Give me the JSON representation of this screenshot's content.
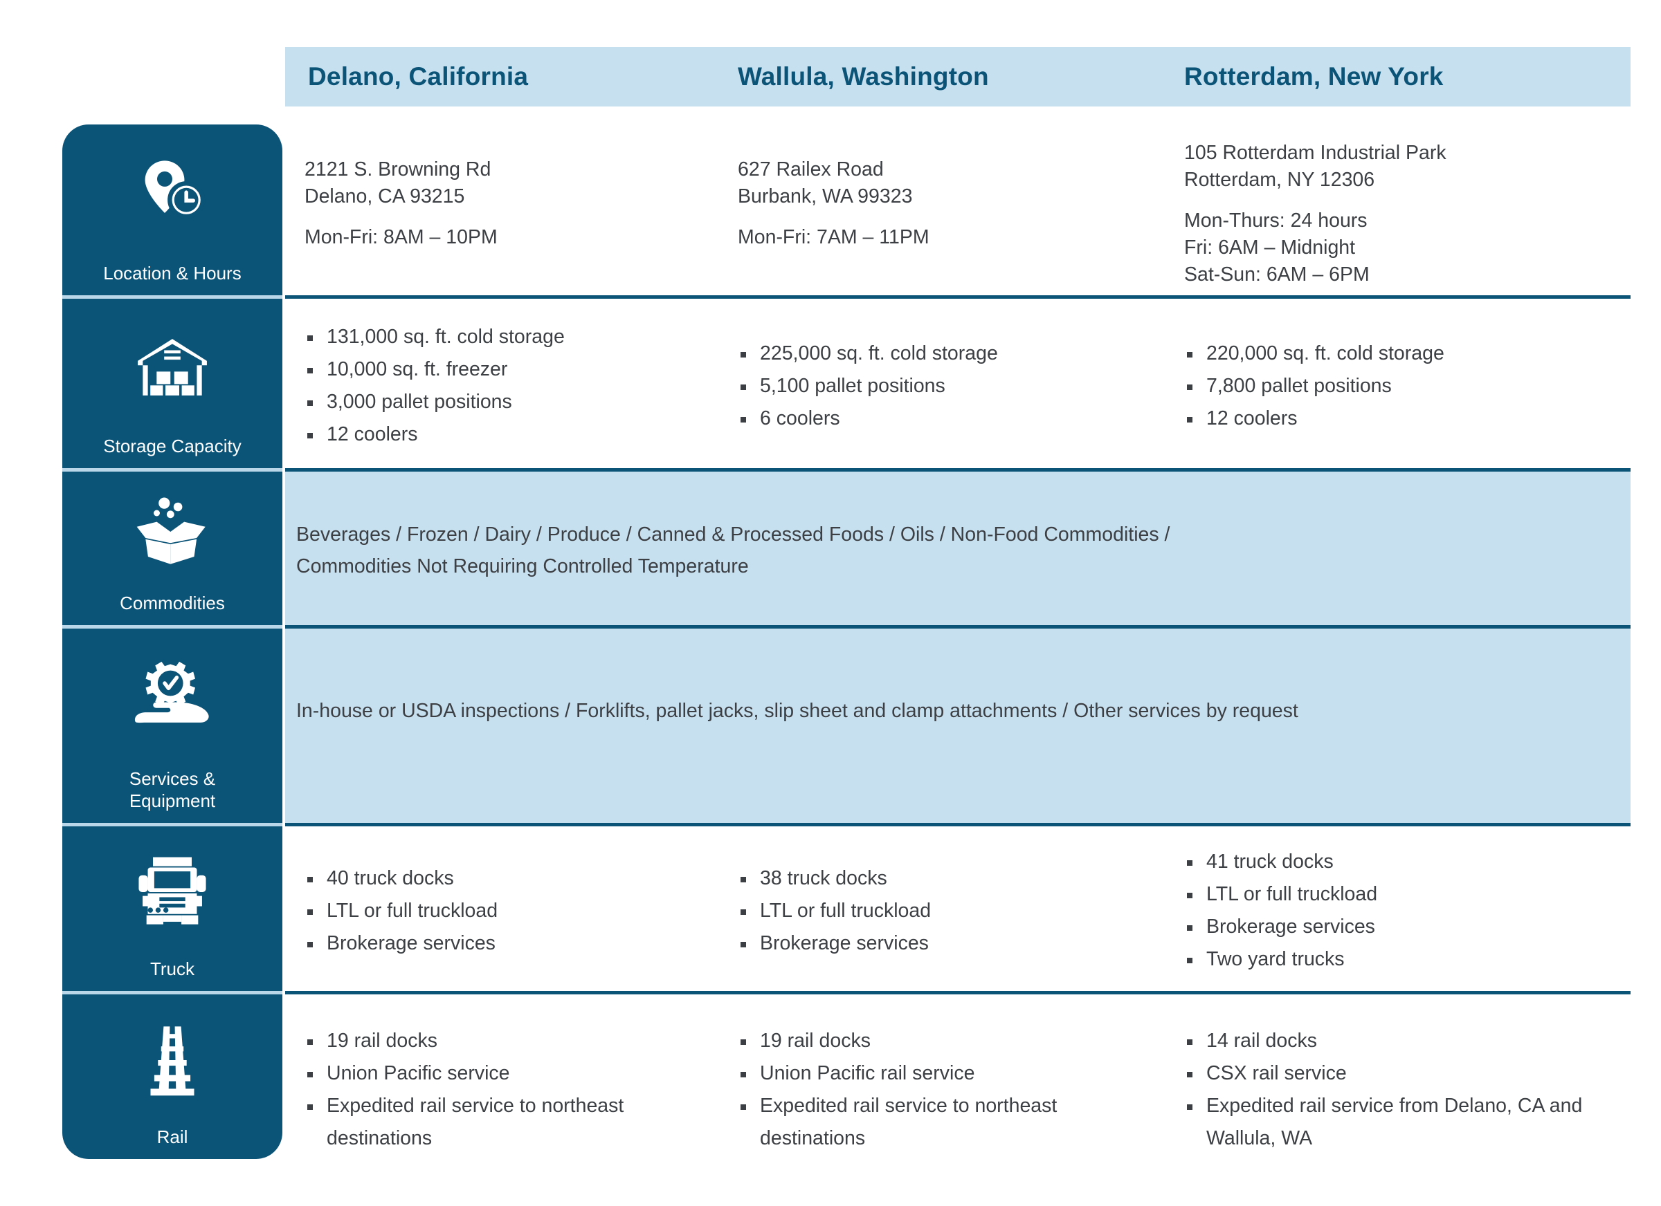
{
  "colors": {
    "dark_blue": "#0b5377",
    "light_blue_band": "#c7e0ef",
    "text_gray": "#3c3f43",
    "divider_light": "#b9d7e8"
  },
  "header": {
    "columns": [
      {
        "label": "Delano, California"
      },
      {
        "label": "Wallula, Washington"
      },
      {
        "label": "Rotterdam, New York"
      }
    ]
  },
  "rows": [
    {
      "id": "location-hours",
      "icon": "location-pin-clock-icon",
      "label": "Location & Hours",
      "layout": "columns",
      "shaded": false,
      "columns": [
        {
          "lines": [
            "2121 S. Browning Rd",
            "Delano, CA 93215"
          ],
          "hours": [
            "Mon-Fri: 8AM – 10PM"
          ]
        },
        {
          "lines": [
            "627 Railex Road",
            "Burbank, WA 99323"
          ],
          "hours": [
            "Mon-Fri: 7AM – 11PM"
          ]
        },
        {
          "lines": [
            "105 Rotterdam Industrial Park",
            "Rotterdam, NY 12306"
          ],
          "hours": [
            "Mon-Thurs: 24 hours",
            "Fri: 6AM – Midnight",
            "Sat-Sun: 6AM – 6PM"
          ]
        }
      ]
    },
    {
      "id": "storage-capacity",
      "icon": "warehouse-icon",
      "label": "Storage Capacity",
      "layout": "columns",
      "shaded": false,
      "columns": [
        {
          "bullets": [
            "131,000 sq. ft. cold storage",
            "10,000 sq. ft. freezer",
            "3,000 pallet positions",
            "12 coolers"
          ]
        },
        {
          "bullets": [
            "225,000 sq. ft. cold storage",
            "5,100 pallet positions",
            "6 coolers"
          ]
        },
        {
          "bullets": [
            "220,000 sq. ft. cold storage",
            "7,800 pallet positions",
            "12 coolers"
          ]
        }
      ]
    },
    {
      "id": "commodities",
      "icon": "open-box-icon",
      "label": "Commodities",
      "layout": "full",
      "shaded": true,
      "text_lines": [
        "Beverages / Frozen / Dairy / Produce / Canned & Processed Foods / Oils / Non-Food Commodities /",
        "Commodities Not Requiring Controlled Temperature"
      ]
    },
    {
      "id": "services-equipment",
      "icon": "gear-in-hand-icon",
      "label": "Services &\nEquipment",
      "label_lines": [
        "Services &",
        "Equipment"
      ],
      "layout": "full",
      "shaded": true,
      "text_lines": [
        "In-house or USDA inspections  /  Forklifts, pallet jacks, slip sheet and clamp attachments  /  Other services by request"
      ]
    },
    {
      "id": "truck",
      "icon": "truck-icon",
      "label": "Truck",
      "layout": "columns",
      "shaded": false,
      "columns": [
        {
          "bullets": [
            "40 truck docks",
            "LTL or full truckload",
            "Brokerage services"
          ]
        },
        {
          "bullets": [
            "38 truck docks",
            "LTL or full truckload",
            "Brokerage services"
          ]
        },
        {
          "bullets": [
            "41 truck docks",
            "LTL or full truckload",
            "Brokerage services",
            "Two yard trucks"
          ]
        }
      ]
    },
    {
      "id": "rail",
      "icon": "railroad-track-icon",
      "label": "Rail",
      "layout": "columns",
      "shaded": false,
      "columns": [
        {
          "bullets": [
            "19 rail docks",
            "Union Pacific service",
            "Expedited rail service to northeast destinations"
          ]
        },
        {
          "bullets": [
            "19 rail docks",
            "Union Pacific rail service",
            "Expedited rail service to northeast destinations"
          ]
        },
        {
          "bullets": [
            "14 rail docks",
            "CSX rail service",
            "Expedited rail service from Delano, CA and Wallula, WA"
          ]
        }
      ]
    }
  ]
}
